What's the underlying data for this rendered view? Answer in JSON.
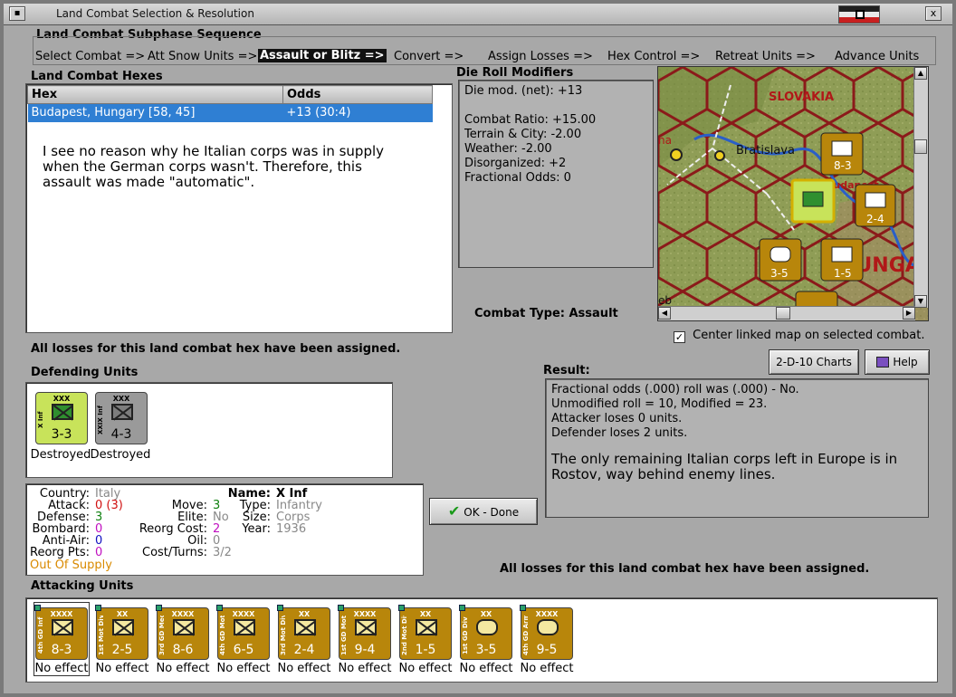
{
  "window": {
    "title": "Land Combat Selection & Resolution",
    "close": "x",
    "system_icon": "window-menu-icon"
  },
  "sequence": {
    "title": "Land Combat Subphase Sequence",
    "steps": [
      {
        "label": "Select Combat =>"
      },
      {
        "label": "Att Snow Units =>"
      },
      {
        "label": "Assault or Blitz =>"
      },
      {
        "label": "Convert =>"
      },
      {
        "label": "Assign Losses =>"
      },
      {
        "label": "Hex Control =>"
      },
      {
        "label": "Retreat Units =>"
      },
      {
        "label": "Advance Units"
      }
    ]
  },
  "hexes": {
    "title": "Land Combat Hexes",
    "columns": [
      "Hex",
      "Odds"
    ],
    "rows": [
      [
        "Budapest, Hungary [58, 45]",
        "+13 (30:4)"
      ]
    ],
    "note": "I see no reason why he Italian corps was in supply\nwhen the German corps wasn't.  Therefore, this\nassault was made \"automatic\"."
  },
  "modifiers": {
    "title": "Die Roll Modifiers",
    "lines": [
      "Die mod. (net): +13",
      "",
      "Combat Ratio: +15.00",
      "Terrain & City: -2.00",
      "Weather: -2.00",
      "Disorganized: +2",
      "Fractional Odds: 0"
    ]
  },
  "map": {
    "labels": {
      "slovakia": "SLOVAKIA",
      "bratislava": "Bratislava",
      "hungary": "HUNGAR",
      "budapest": "Budapest",
      "corner": "eb",
      "partial": "na"
    }
  },
  "combat_type": {
    "label": "Combat Type:",
    "value": "Assault"
  },
  "center_map": {
    "checked": true,
    "label": "Center linked map on selected combat."
  },
  "losses_msg_left": "All losses for this land combat hex have been assigned.",
  "losses_msg_right": "All losses for this land combat hex have been assigned.",
  "buttons": {
    "charts": "2-D-10 Charts",
    "help": "Help",
    "ok": "OK - Done"
  },
  "defending": {
    "title": "Defending Units",
    "units": [
      {
        "size": "XXX",
        "name": "X Inf",
        "strength": "3-3",
        "result": "Destroyed",
        "color": "#c8e35a"
      },
      {
        "size": "XXX",
        "name": "XXIX Inf",
        "strength": "4-3",
        "result": "Destroyed",
        "color": "#9a9a9a"
      }
    ]
  },
  "result": {
    "title": "Result:",
    "lines": [
      "Fractional odds (.000) roll was (.000)  -  No.",
      "Unmodified roll = 10, Modified = 23.",
      "Attacker loses 0 units.",
      "Defender loses 2 units."
    ],
    "note": "The only remaining Italian corps left in Europe is in Rostov, way behind enemy lines."
  },
  "unit_info": {
    "country_label": "Country:",
    "country": "Italy",
    "attack_label": "Attack:",
    "attack": "0",
    "attack_orig": "(3)",
    "defense_label": "Defense:",
    "defense": "3",
    "bombard_label": "Bombard:",
    "bombard": "0",
    "antiair_label": "Anti-Air:",
    "antiair": "0",
    "reorgpts_label": "Reorg Pts:",
    "reorgpts": "0",
    "supply": "Out Of Supply",
    "move_label": "Move:",
    "move": "3",
    "elite_label": "Elite:",
    "elite": "No",
    "reorgcost_label": "Reorg Cost:",
    "reorgcost": "2",
    "oil_label": "Oil:",
    "oil": "0",
    "costturns_label": "Cost/Turns:",
    "costturns": "3/2",
    "name_label": "Name:",
    "name": "X Inf",
    "type_label": "Type:",
    "type": "Infantry",
    "size_label": "Size:",
    "size": "Corps",
    "year_label": "Year:",
    "year": "1936"
  },
  "attacking": {
    "title": "Attacking Units",
    "units": [
      {
        "size": "XXXX",
        "name": "4th GD Inf",
        "strength": "8-3",
        "symbol": "inf",
        "result": "No effect"
      },
      {
        "size": "XX",
        "name": "1st Mot Div",
        "strength": "2-5",
        "symbol": "inf",
        "result": "No effect"
      },
      {
        "size": "XXXX",
        "name": "3rd GD Mech",
        "strength": "8-6",
        "symbol": "inf",
        "result": "No effect"
      },
      {
        "size": "XXXX",
        "name": "4th GD Mot",
        "strength": "6-5",
        "symbol": "inf",
        "result": "No effect"
      },
      {
        "size": "XX",
        "name": "3rd Mot Div",
        "strength": "2-4",
        "symbol": "inf",
        "result": "No effect"
      },
      {
        "size": "XXXX",
        "name": "1st GD Mot",
        "strength": "9-4",
        "symbol": "inf",
        "result": "No effect"
      },
      {
        "size": "XX",
        "name": "2nd Mot Div",
        "strength": "1-5",
        "symbol": "inf",
        "result": "No effect"
      },
      {
        "size": "XX",
        "name": "1st GD Div",
        "strength": "3-5",
        "symbol": "arm",
        "result": "No effect"
      },
      {
        "size": "XXXX",
        "name": "4th GD Arm",
        "strength": "9-5",
        "symbol": "arm",
        "result": "No effect"
      }
    ]
  },
  "colors": {
    "german_counter": "#b8860b",
    "italian_counter": "#c8e35a",
    "selection": "#2f7fd3",
    "supply_warning": "#d98a00"
  }
}
